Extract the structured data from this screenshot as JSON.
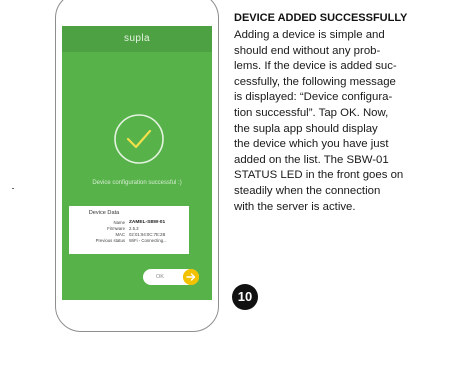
{
  "phone": {
    "app_title": "supla",
    "config_message": "Device configuration successful :)",
    "device_card": {
      "title": "Device Data",
      "rows": [
        {
          "label": "Name",
          "value": "ZAMEL-SBW-01"
        },
        {
          "label": "Firmware",
          "value": "2.5.3"
        },
        {
          "label": "MAC",
          "value": "02:01:94:0C:7E:2B"
        },
        {
          "label": "Previous status",
          "value": "WiFi - Connecting..."
        }
      ]
    },
    "ok_label": "OK",
    "accent_color": "#57b24a",
    "button_accent": "#f2c100"
  },
  "text": {
    "heading": "DEVICE ADDED SUCCESSFULLY",
    "lines": [
      "Adding a device is simple and",
      "should end without any prob-",
      "lems. If the device is added suc-",
      "cessfully, the following message",
      "is displayed: “Device configura-",
      "tion successful”. Tap OK. Now,",
      "the supla app should display",
      "the device which you have just",
      "added on the list. The SBW-01",
      "STATUS LED in the front goes on",
      "steadily when the connection",
      "with the server is active."
    ]
  },
  "step_number": "10"
}
